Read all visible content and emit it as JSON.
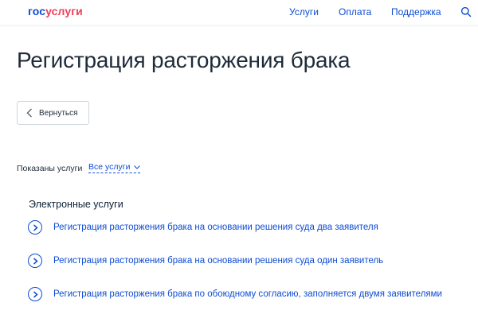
{
  "header": {
    "logo_part1": "гос",
    "logo_part2": "услуги",
    "nav": [
      "Услуги",
      "Оплата",
      "Поддержка"
    ],
    "search_icon": "search-icon",
    "brand_color": "#0d4cd3",
    "logo_accent_color": "#ee3f58"
  },
  "page": {
    "title": "Регистрация расторжения брака"
  },
  "back_button": {
    "label": "Вернуться",
    "icon": "chevron-left-icon"
  },
  "filter": {
    "label": "Показаны услуги",
    "selected": "Все услуги",
    "icon": "chevron-down-icon"
  },
  "electronic_services": {
    "title": "Электронные услуги",
    "items": [
      "Регистрация расторжения брака на основании решения суда два заявителя",
      "Регистрация расторжения брака на основании решения суда один заявитель",
      "Регистрация расторжения брака по обоюдному согласию, заполняется двумя заявителями"
    ],
    "item_icon": "chevron-right-circle-icon"
  }
}
